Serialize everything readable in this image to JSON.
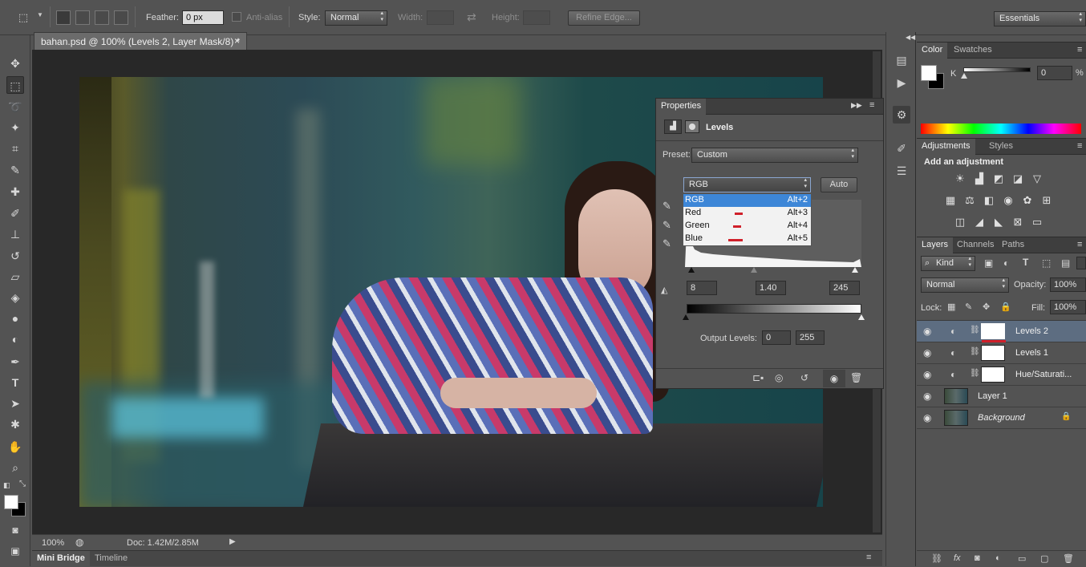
{
  "options_bar": {
    "feather_label": "Feather:",
    "feather_value": "0 px",
    "anti_alias_label": "Anti-alias",
    "style_label": "Style:",
    "style_value": "Normal",
    "width_label": "Width:",
    "height_label": "Height:",
    "refine_edge_label": "Refine Edge...",
    "workspace_value": "Essentials"
  },
  "document": {
    "tab_title": "bahan.psd @ 100% (Levels 2, Layer Mask/8) *",
    "close_glyph": "×",
    "zoom": "100%",
    "doc_info": "Doc: 1.42M/2.85M"
  },
  "bottom_tabs": [
    "Mini Bridge",
    "Timeline"
  ],
  "properties": {
    "tab_label": "Properties",
    "title": "Levels",
    "preset_label": "Preset:",
    "preset_value": "Custom",
    "channel_value": "RGB",
    "auto_label": "Auto",
    "channel_options": [
      {
        "label": "RGB",
        "shortcut": "Alt+2"
      },
      {
        "label": "Red",
        "shortcut": "Alt+3"
      },
      {
        "label": "Green",
        "shortcut": "Alt+4"
      },
      {
        "label": "Blue",
        "shortcut": "Alt+5"
      }
    ],
    "input_black": "8",
    "input_gamma": "1.40",
    "input_white": "245",
    "output_label": "Output Levels:",
    "output_black": "0",
    "output_white": "255"
  },
  "color_panel": {
    "tabs": [
      "Color",
      "Swatches"
    ],
    "channel_label": "K",
    "value": "0",
    "unit": "%"
  },
  "adjustments_panel": {
    "tabs": [
      "Adjustments",
      "Styles"
    ],
    "heading": "Add an adjustment"
  },
  "layers_panel": {
    "tabs": [
      "Layers",
      "Channels",
      "Paths"
    ],
    "filter_label": "Kind",
    "blend_mode": "Normal",
    "opacity_label": "Opacity:",
    "opacity_value": "100%",
    "lock_label": "Lock:",
    "fill_label": "Fill:",
    "fill_value": "100%",
    "layers": [
      {
        "name": "Levels 2",
        "selected": true
      },
      {
        "name": "Levels 1",
        "selected": false
      },
      {
        "name": "Hue/Saturati...",
        "selected": false
      },
      {
        "name": "Layer 1",
        "selected": false
      },
      {
        "name": "Background",
        "selected": false
      }
    ]
  },
  "colors": {
    "selection_blue": "#3d86d7",
    "selected_layer": "#5d6d81",
    "annotation_red": "#d0202a"
  }
}
